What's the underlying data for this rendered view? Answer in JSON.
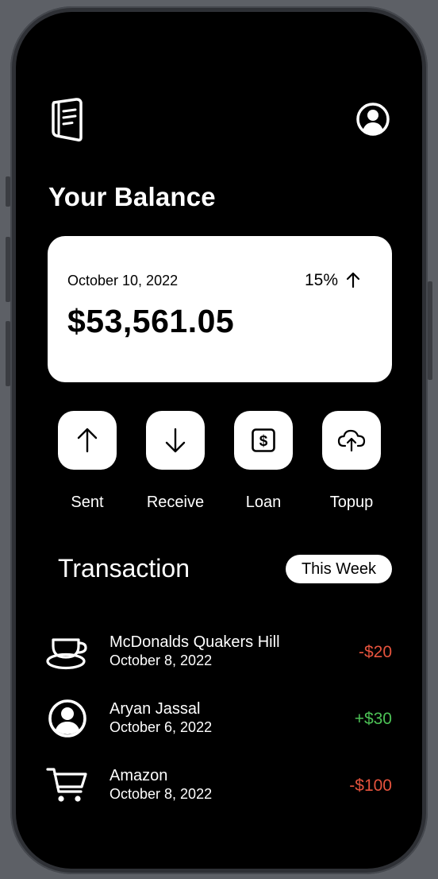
{
  "header": {
    "logo_icon": "receipt-book-icon",
    "profile_icon": "user-circle-icon"
  },
  "balance": {
    "heading": "Your Balance",
    "date": "October 10, 2022",
    "percent": "15%",
    "trend_icon": "arrow-up-icon",
    "amount": "$53,561.05"
  },
  "actions": [
    {
      "label": "Sent",
      "icon": "arrow-up-icon"
    },
    {
      "label": "Receive",
      "icon": "arrow-down-icon"
    },
    {
      "label": "Loan",
      "icon": "dollar-box-icon"
    },
    {
      "label": "Topup",
      "icon": "cloud-upload-icon"
    }
  ],
  "transactions": {
    "heading": "Transaction",
    "filter": "This Week",
    "items": [
      {
        "name": "McDonalds Quakers Hill",
        "date": "October 8, 2022",
        "amount": "-$20",
        "icon": "coffee-cup-icon",
        "status_color": "#e5533d"
      },
      {
        "name": "Aryan Jassal",
        "date": "October 6, 2022",
        "amount": "+$30",
        "icon": "user-circle-icon",
        "status_color": "#4cc155"
      },
      {
        "name": "Amazon",
        "date": "October 8, 2022",
        "amount": "-$100",
        "icon": "shopping-cart-icon",
        "status_color": "#e5533d"
      }
    ]
  },
  "colors": {
    "background": "#000000",
    "card": "#ffffff",
    "negative": "#e5533d",
    "positive": "#4cc155"
  }
}
